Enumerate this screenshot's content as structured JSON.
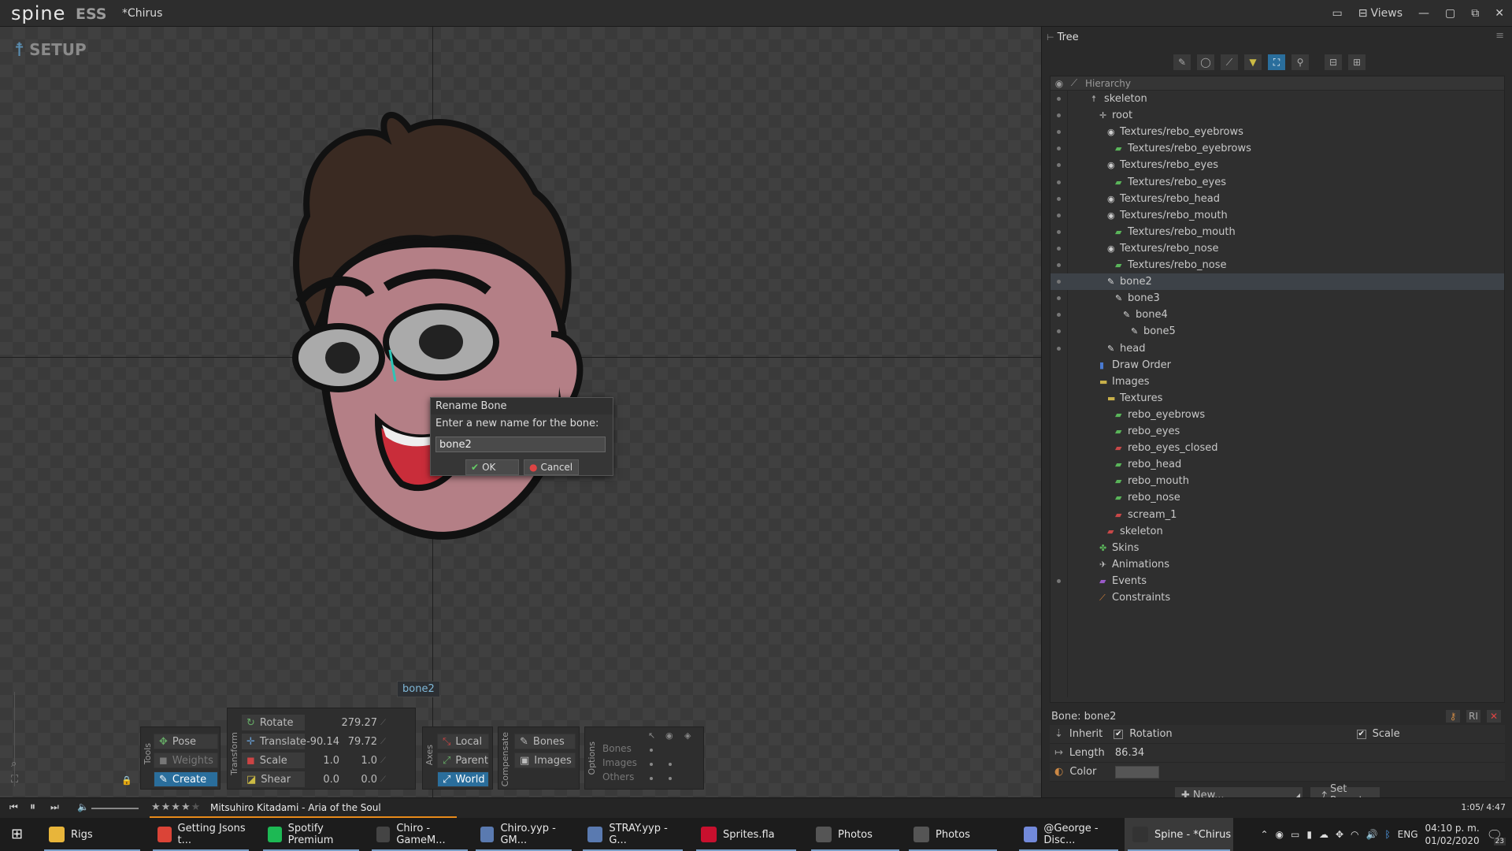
{
  "app": {
    "logo": "spine",
    "edition": "ESS",
    "doc_title": "*Chirus",
    "views_label": "Views"
  },
  "viewport": {
    "mode_label": "SETUP",
    "selected_bone_tag": "bone2"
  },
  "dialog": {
    "title": "Rename Bone",
    "prompt": "Enter a new name for the bone:",
    "input_value": "bone2",
    "ok_label": "OK",
    "cancel_label": "Cancel"
  },
  "tools": {
    "section_label": "Tools",
    "pose": "Pose",
    "weights": "Weights",
    "create": "Create"
  },
  "transform": {
    "section_label": "Transform",
    "rotate": {
      "label": "Rotate",
      "value": "279.27"
    },
    "translate": {
      "label": "Translate",
      "x": "-90.14",
      "y": "79.72"
    },
    "scale": {
      "label": "Scale",
      "x": "1.0",
      "y": "1.0"
    },
    "shear": {
      "label": "Shear",
      "x": "0.0",
      "y": "0.0"
    }
  },
  "axes": {
    "section_label": "Axes",
    "local": "Local",
    "parent": "Parent",
    "world": "World"
  },
  "compensate": {
    "section_label": "Compensate",
    "bones": "Bones",
    "images": "Images"
  },
  "options": {
    "section_label": "Options",
    "bones": "Bones",
    "images": "Images",
    "others": "Others"
  },
  "tree": {
    "tab_label": "Tree",
    "hierarchy_label": "Hierarchy",
    "rows": [
      {
        "label": "skeleton",
        "icon": "skeleton-icon",
        "indent": 0,
        "eye": true
      },
      {
        "label": "root",
        "icon": "bone-root-icon",
        "indent": 1,
        "eye": true
      },
      {
        "label": "Textures/rebo_eyebrows",
        "icon": "slot-icon",
        "indent": 2,
        "eye": true
      },
      {
        "label": "Textures/rebo_eyebrows",
        "icon": "image-icon",
        "indent": 3,
        "eye": true
      },
      {
        "label": "Textures/rebo_eyes",
        "icon": "slot-icon",
        "indent": 2,
        "eye": true
      },
      {
        "label": "Textures/rebo_eyes",
        "icon": "image-icon",
        "indent": 3,
        "eye": true
      },
      {
        "label": "Textures/rebo_head",
        "icon": "slot-icon",
        "indent": 2,
        "eye": true
      },
      {
        "label": "Textures/rebo_mouth",
        "icon": "slot-icon",
        "indent": 2,
        "eye": true
      },
      {
        "label": "Textures/rebo_mouth",
        "icon": "image-icon",
        "indent": 3,
        "eye": true
      },
      {
        "label": "Textures/rebo_nose",
        "icon": "slot-icon",
        "indent": 2,
        "eye": true
      },
      {
        "label": "Textures/rebo_nose",
        "icon": "image-icon",
        "indent": 3,
        "eye": true
      },
      {
        "label": "bone2",
        "icon": "bone-icon",
        "indent": 2,
        "eye": true,
        "selected": true
      },
      {
        "label": "bone3",
        "icon": "bone-icon",
        "indent": 3,
        "eye": true
      },
      {
        "label": "bone4",
        "icon": "bone-icon",
        "indent": 4,
        "eye": true
      },
      {
        "label": "bone5",
        "icon": "bone-icon",
        "indent": 5,
        "eye": true
      },
      {
        "label": "head",
        "icon": "bone-icon",
        "indent": 2,
        "eye": true
      },
      {
        "label": "Draw Order",
        "icon": "draw-order-icon",
        "indent": 1,
        "eye": false
      },
      {
        "label": "Images",
        "icon": "folder-icon",
        "indent": 1,
        "eye": false
      },
      {
        "label": "Textures",
        "icon": "folder-icon",
        "indent": 2,
        "eye": false
      },
      {
        "label": "rebo_eyebrows",
        "icon": "image-icon",
        "indent": 3,
        "eye": false
      },
      {
        "label": "rebo_eyes",
        "icon": "image-icon",
        "indent": 3,
        "eye": false
      },
      {
        "label": "rebo_eyes_closed",
        "icon": "image-red-icon",
        "indent": 3,
        "eye": false
      },
      {
        "label": "rebo_head",
        "icon": "image-icon",
        "indent": 3,
        "eye": false
      },
      {
        "label": "rebo_mouth",
        "icon": "image-icon",
        "indent": 3,
        "eye": false
      },
      {
        "label": "rebo_nose",
        "icon": "image-icon",
        "indent": 3,
        "eye": false
      },
      {
        "label": "scream_1",
        "icon": "image-red-icon",
        "indent": 3,
        "eye": false
      },
      {
        "label": "skeleton",
        "icon": "image-red-icon",
        "indent": 2,
        "eye": false
      },
      {
        "label": "Skins",
        "icon": "skins-icon",
        "indent": 1,
        "eye": false
      },
      {
        "label": "Animations",
        "icon": "animations-icon",
        "indent": 1,
        "eye": false
      },
      {
        "label": "Events",
        "icon": "events-icon",
        "indent": 1,
        "eye": true
      },
      {
        "label": "Constraints",
        "icon": "constraints-icon",
        "indent": 1,
        "eye": false
      }
    ]
  },
  "bone_props": {
    "title": "Bone: bone2",
    "inherit_label": "Inherit",
    "rotation_label": "Rotation",
    "scale_label": "Scale",
    "length_label": "Length",
    "length_value": "86.34",
    "color_label": "Color",
    "new_label": "New...",
    "set_parent_label": "Set Parent"
  },
  "player": {
    "track": "Mitsuhiro Kitadami - Aria of the Soul",
    "time": "1:05/ 4:47",
    "rating_stars": 4
  },
  "taskbar": {
    "items": [
      {
        "label": "Rigs",
        "icon": "folder-icon",
        "color": "#e8b53a"
      },
      {
        "label": "Getting Jsons t...",
        "icon": "chrome-icon",
        "color": "#db4437"
      },
      {
        "label": "Spotify Premium",
        "icon": "spotify-icon",
        "color": "#1db954"
      },
      {
        "label": "Chiro - GameM...",
        "icon": "gamemaker-icon",
        "color": "#444444"
      },
      {
        "label": "Chiro.yyp - GM...",
        "icon": "gms-icon",
        "color": "#5a7ab0"
      },
      {
        "label": "STRAY.yyp - G...",
        "icon": "gms-icon",
        "color": "#5a7ab0"
      },
      {
        "label": "Sprites.fla",
        "icon": "flash-icon",
        "color": "#c8102e"
      },
      {
        "label": "Photos",
        "icon": "photos-icon",
        "color": "#555555"
      },
      {
        "label": "Photos",
        "icon": "photos-icon",
        "color": "#555555"
      },
      {
        "label": "@George - Disc...",
        "icon": "discord-icon",
        "color": "#7289da"
      },
      {
        "label": "Spine - *Chirus",
        "icon": "spine-icon",
        "color": "#333333"
      }
    ],
    "lang": "ENG",
    "time": "04:10 p. m.",
    "date": "01/02/2020",
    "notifications": "23"
  }
}
